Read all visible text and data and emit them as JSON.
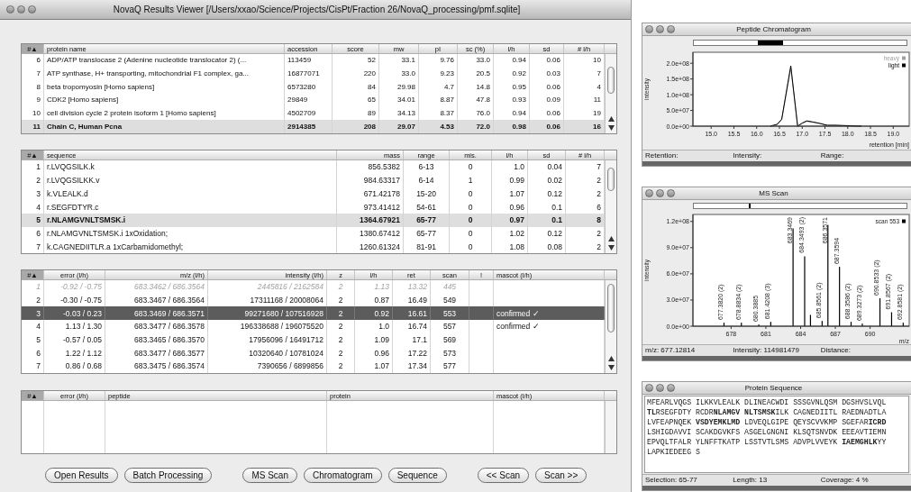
{
  "window": {
    "title": "NovaQ Results Viewer [/Users/xxao/Science/Projects/CisPt/Fraction 26/NovaQ_processing/pmf.sqlite]"
  },
  "proteins": {
    "columns": [
      "#▲",
      "protein name",
      "accession",
      "score",
      "mw",
      "pI",
      "sc (%)",
      "l/h",
      "sd",
      "# l/h"
    ],
    "rows": [
      {
        "cells": [
          "6",
          "ADP/ATP translocase 2 (Adenine nucleotide translocator 2) (...",
          "113459",
          "52",
          "33.1",
          "9.76",
          "33.0",
          "0.94",
          "0.06",
          "10"
        ],
        "selected": false
      },
      {
        "cells": [
          "7",
          "ATP synthase, H+ transporting, mitochondrial F1 complex, ga...",
          "16877071",
          "220",
          "33.0",
          "9.23",
          "20.5",
          "0.92",
          "0.03",
          "7"
        ],
        "selected": false
      },
      {
        "cells": [
          "8",
          "beta tropomyosin [Homo sapiens]",
          "6573280",
          "84",
          "29.98",
          "4.7",
          "14.8",
          "0.95",
          "0.06",
          "4"
        ],
        "selected": false
      },
      {
        "cells": [
          "9",
          "CDK2 [Homo sapiens]",
          "29849",
          "65",
          "34.01",
          "8.87",
          "47.8",
          "0.93",
          "0.09",
          "11"
        ],
        "selected": false
      },
      {
        "cells": [
          "10",
          "cell division cycle 2 protein isoform 1 [Homo sapiens]",
          "4502709",
          "89",
          "34.13",
          "8.37",
          "76.0",
          "0.94",
          "0.06",
          "19"
        ],
        "selected": false
      },
      {
        "cells": [
          "11",
          "Chain C, Human Pcna",
          "2914385",
          "208",
          "29.07",
          "4.53",
          "72.0",
          "0.98",
          "0.06",
          "16"
        ],
        "selected": true
      }
    ]
  },
  "peptides": {
    "columns": [
      "#▲",
      "sequence",
      "mass",
      "range",
      "mis.",
      "l/h",
      "sd",
      "# l/h"
    ],
    "rows": [
      {
        "cells": [
          "1",
          "r.LVQGSILK.k",
          "856.5382",
          "6-13",
          "0",
          "1.0",
          "0.04",
          "7"
        ],
        "selected": false
      },
      {
        "cells": [
          "2",
          "r.LVQGSILKK.v",
          "984.63317",
          "6-14",
          "1",
          "0.99",
          "0.02",
          "2"
        ],
        "selected": false
      },
      {
        "cells": [
          "3",
          "k.VLEALK.d",
          "671.42178",
          "15-20",
          "0",
          "1.07",
          "0.12",
          "2"
        ],
        "selected": false
      },
      {
        "cells": [
          "4",
          "r.SEGFDTYR.c",
          "973.41412",
          "54-61",
          "0",
          "0.96",
          "0.1",
          "6"
        ],
        "selected": false
      },
      {
        "cells": [
          "5",
          "r.NLAMGVNLTSMSK.i",
          "1364.67921",
          "65-77",
          "0",
          "0.97",
          "0.1",
          "8"
        ],
        "selected": true
      },
      {
        "cells": [
          "6",
          "r.NLAMGVNLTSMSK.i 1xOxidation;",
          "1380.67412",
          "65-77",
          "0",
          "1.02",
          "0.12",
          "2"
        ],
        "selected": false
      },
      {
        "cells": [
          "7",
          "k.CAGNEDIITLR.a 1xCarbamidomethyl;",
          "1260.61324",
          "81-91",
          "0",
          "1.08",
          "0.08",
          "2"
        ],
        "selected": false
      }
    ]
  },
  "scans": {
    "columns": [
      "#▲",
      "error (l/h)",
      "m/z (l/h)",
      "intensity (l/h)",
      "z",
      "l/h",
      "ret",
      "scan",
      "!",
      "mascot (l/h)"
    ],
    "rows": [
      {
        "cells": [
          "1",
          "-0.92 / -0.75",
          "683.3462 / 686.3564",
          "2445816 / 2162584",
          "2",
          "1.13",
          "13.32",
          "445"
        ],
        "selected": false,
        "disabled": true
      },
      {
        "cells": [
          "2",
          "-0.30 / -0.75",
          "683.3467 / 686.3564",
          "17311168 / 20008064",
          "2",
          "0.87",
          "16.49",
          "549"
        ],
        "selected": false,
        "disabled": false
      },
      {
        "cells": [
          "3",
          "-0.03 / 0.23",
          "683.3469 / 686.3571",
          "99271680 / 107516928",
          "2",
          "0.92",
          "16.61",
          "553"
        ],
        "mascot": "confirmed ✓",
        "selected": true,
        "disabled": false
      },
      {
        "cells": [
          "4",
          "1.13 / 1.30",
          "683.3477 / 686.3578",
          "196338688 / 196075520",
          "2",
          "1.0",
          "16.74",
          "557"
        ],
        "mascot": "confirmed ✓",
        "selected": false,
        "disabled": false
      },
      {
        "cells": [
          "5",
          "-0.57 / 0.05",
          "683.3465 / 686.3570",
          "17956096 / 16491712",
          "2",
          "1.09",
          "17.1",
          "569"
        ],
        "selected": false,
        "disabled": false
      },
      {
        "cells": [
          "6",
          "1.22 / 1.12",
          "683.3477 / 686.3577",
          "10320640 / 10781024",
          "2",
          "0.96",
          "17.22",
          "573"
        ],
        "selected": false,
        "disabled": false
      },
      {
        "cells": [
          "7",
          "0.86 / 0.68",
          "683.3475 / 686.3574",
          "7390656 / 6899856",
          "2",
          "1.07",
          "17.34",
          "577"
        ],
        "selected": false,
        "disabled": false
      }
    ]
  },
  "matches": {
    "columns": [
      "#▲",
      "error (l/h)",
      "peptide",
      "protein",
      "mascot (l/h)"
    ]
  },
  "button_groups": [
    [
      "Open Results",
      "Batch Processing"
    ],
    [
      "MS Scan",
      "Chromatogram",
      "Sequence"
    ],
    [
      "<< Scan",
      "Scan >>"
    ]
  ],
  "chromatogram": {
    "title": "Peptide Chromatogram",
    "chart_data": {
      "type": "line",
      "xlabel": "retention [min]",
      "ylabel": "intensity",
      "xlim": [
        14.6,
        19.35
      ],
      "ylim": [
        0,
        235000000
      ],
      "x": [
        16.3,
        16.45,
        16.55,
        16.75,
        16.9,
        17.0,
        17.1,
        17.25,
        17.4,
        17.55,
        17.7,
        17.9,
        18.1,
        18.3
      ],
      "series": [
        {
          "name": "heavy",
          "color": "#a0a0a0",
          "values": [
            0,
            5000000,
            20000000,
            185000000,
            0,
            8000000,
            15000000,
            12000000,
            9000000,
            2000000,
            3000000,
            2000000,
            2000000,
            0
          ]
        },
        {
          "name": "light",
          "color": "#000000",
          "values": [
            0,
            6000000,
            22000000,
            192000000,
            0,
            10000000,
            17000000,
            13000000,
            8000000,
            3000000,
            3000000,
            2000000,
            1000000,
            0
          ]
        }
      ],
      "xticks": [
        {
          "value": 15,
          "label": "15.0"
        },
        15.5,
        {
          "value": 16,
          "label": "16.0"
        },
        16.5,
        {
          "value": 17,
          "label": "17.0"
        },
        17.5,
        {
          "value": 18,
          "label": "18.0"
        },
        18.5,
        {
          "value": 19,
          "label": "19.0"
        }
      ],
      "legend": "upper right",
      "yticks": [
        {
          "value": 0,
          "label": "0.0e+00"
        },
        {
          "value": 50000000,
          "label": "5.0e+07"
        },
        {
          "value": 100000000,
          "label": "1.0e+08"
        },
        {
          "value": 150000000,
          "label": "1.5e+08"
        },
        {
          "value": 200000000,
          "label": "2.0e+08"
        }
      ]
    },
    "status": [
      "Retention:",
      "Intensity:",
      "Range:"
    ]
  },
  "ms_scan": {
    "title": "MS Scan",
    "chart_data": {
      "type": "bar",
      "xlabel": "m/z",
      "ylabel": "intensity",
      "xlim": [
        674.7,
        693.3
      ],
      "ylim": [
        0,
        128000000
      ],
      "x": [
        677.382,
        678.883,
        680.388,
        681.421,
        683.347,
        684.349,
        684.85,
        685.856,
        686.357,
        687.359,
        688.359,
        689.327,
        690.853,
        691.857,
        692.858
      ],
      "series": [
        {
          "name": "scan 553",
          "color": "#000000",
          "values": [
            4000000,
            4000000,
            2000000,
            5000000,
            112000000,
            80000000,
            13000000,
            6000000,
            116000000,
            68000000,
            5000000,
            3000000,
            32000000,
            16000000,
            4000000
          ]
        }
      ],
      "xticks": [
        678,
        681,
        684,
        687,
        690
      ],
      "legend": "upper right",
      "yticks": [
        {
          "value": 0,
          "label": "0.0e+00"
        },
        {
          "value": 30000000,
          "label": "3.0e+07"
        },
        {
          "value": 60000000,
          "label": "6.0e+07"
        },
        {
          "value": 90000000,
          "label": "9.0e+07"
        },
        {
          "value": 120000000,
          "label": "1.2e+08"
        }
      ],
      "annotations": [
        {
          "x": 677.382,
          "y": 4000000,
          "text": "677.3820 (2)"
        },
        {
          "x": 678.883,
          "y": 4000000,
          "text": "678.8834 (2)"
        },
        {
          "x": 680.388,
          "y": 2000000,
          "text": "680.3885"
        },
        {
          "x": 681.421,
          "y": 5000000,
          "text": "681.4208 (3)"
        },
        {
          "x": 683.347,
          "y": 112000000,
          "text": "683.3469"
        },
        {
          "x": 684.349,
          "y": 80000000,
          "text": "684.3493 (2)"
        },
        {
          "x": 685.856,
          "y": 6000000,
          "text": "685.8561 (2)"
        },
        {
          "x": 686.357,
          "y": 116000000,
          "text": "686.3571"
        },
        {
          "x": 687.359,
          "y": 68000000,
          "text": "687.3594"
        },
        {
          "x": 688.359,
          "y": 5000000,
          "text": "688.3586 (2)"
        },
        {
          "x": 689.327,
          "y": 3000000,
          "text": "689.3273 (2)"
        },
        {
          "x": 690.853,
          "y": 32000000,
          "text": "690.8533 (2)"
        },
        {
          "x": 691.857,
          "y": 16000000,
          "text": "691.8567 (2)"
        },
        {
          "x": 692.858,
          "y": 4000000,
          "text": "692.8581 (2)"
        }
      ]
    },
    "status": [
      "m/z: 677.12814",
      "Intensity: 114981479",
      "Distance:"
    ]
  },
  "sequence": {
    "title": "Protein Sequence",
    "lines": [
      "MFEARLVQGS ILKKVLEALK DLINEACWDI SSSGVNLQSM DGSHVSLVQL",
      "**TL**RSEGFDTY RCDR**NLAMGV** **NLTSMSK**ILK CAGNEDIITL RAEDNADTLA",
      "LVFEAPNQEK **VSDYEMKLMD** LDVEQLGIPE QEYSCVVKMP SGEFAR**ICRD**",
      "LSHIGDAVVI SCAKDGVKFS ASGELGNGNI KLSQTSNVDK EEEAVTIEMN",
      "EPVQLTFALR YLNFFTKATP LSSTVTLSMS ADVPLVVEYK **IAEMGHLK**YY",
      "LAPKIEDEEG S"
    ],
    "status": [
      "Selection: 65-77",
      "Length: 13",
      "Coverage: 4 %"
    ]
  }
}
